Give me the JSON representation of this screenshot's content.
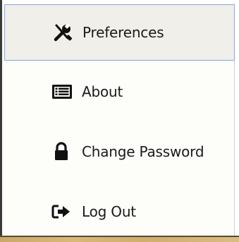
{
  "menu": {
    "items": [
      {
        "label": "Preferences",
        "icon": "tools-icon",
        "active": true
      },
      {
        "label": "About",
        "icon": "list-window-icon",
        "active": false
      },
      {
        "label": "Change Password",
        "icon": "lock-icon",
        "active": false
      },
      {
        "label": "Log Out",
        "icon": "logout-arrow-icon",
        "active": false
      }
    ],
    "colors": {
      "active_border": "#8ea9d6",
      "active_background": "#f1efe9",
      "text": "#1a1a1a"
    }
  }
}
